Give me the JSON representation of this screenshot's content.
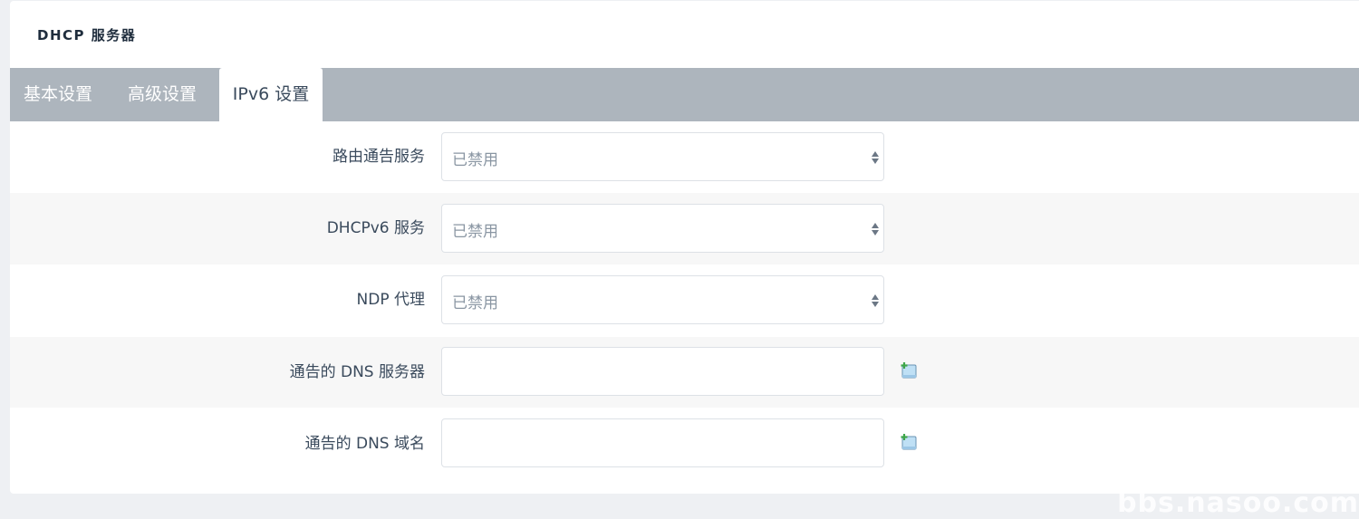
{
  "panel": {
    "title": "DHCP 服务器"
  },
  "tabs": [
    {
      "label": "基本设置",
      "active": false
    },
    {
      "label": "高级设置",
      "active": false
    },
    {
      "label": "IPv6 设置",
      "active": true
    }
  ],
  "fields": {
    "ra": {
      "label": "路由通告服务",
      "value": "已禁用"
    },
    "dhcpv6": {
      "label": "DHCPv6 服务",
      "value": "已禁用"
    },
    "ndp": {
      "label": "NDP 代理",
      "value": "已禁用"
    },
    "dns_server": {
      "label": "通告的 DNS 服务器",
      "value": "",
      "add_icon": "add-list-icon"
    },
    "dns_domain": {
      "label": "通告的 DNS 域名",
      "value": "",
      "add_icon": "add-list-icon"
    }
  },
  "colors": {
    "tabbar": "#adb5bd",
    "active_tab": "#ffffff",
    "row_alt": "#f7f7f7",
    "icon_green": "#4caf50",
    "icon_blue": "#bfe0f5"
  },
  "watermark": "bbs.nasoo.com"
}
